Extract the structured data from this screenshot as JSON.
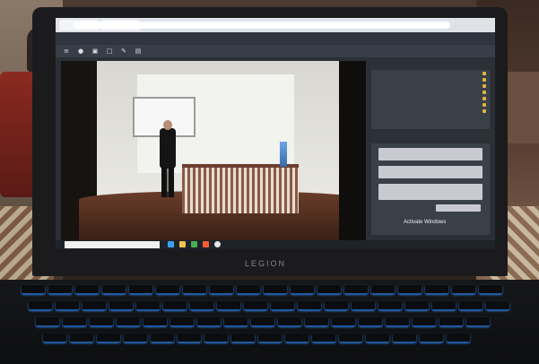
{
  "browser": {
    "tab_1": "",
    "tab_2": "",
    "address": ""
  },
  "app": {
    "header_left": "",
    "header_title": ""
  },
  "sidebar_users": [
    {
      "label": ""
    },
    {
      "label": ""
    },
    {
      "label": ""
    },
    {
      "label": ""
    },
    {
      "label": ""
    },
    {
      "label": ""
    },
    {
      "label": ""
    }
  ],
  "chat": {
    "messages": [],
    "activate_text": "Activate Windows"
  },
  "taskbar": {
    "search_placeholder": "",
    "time": "",
    "date": ""
  },
  "laptop": {
    "brand": "LEGION"
  }
}
